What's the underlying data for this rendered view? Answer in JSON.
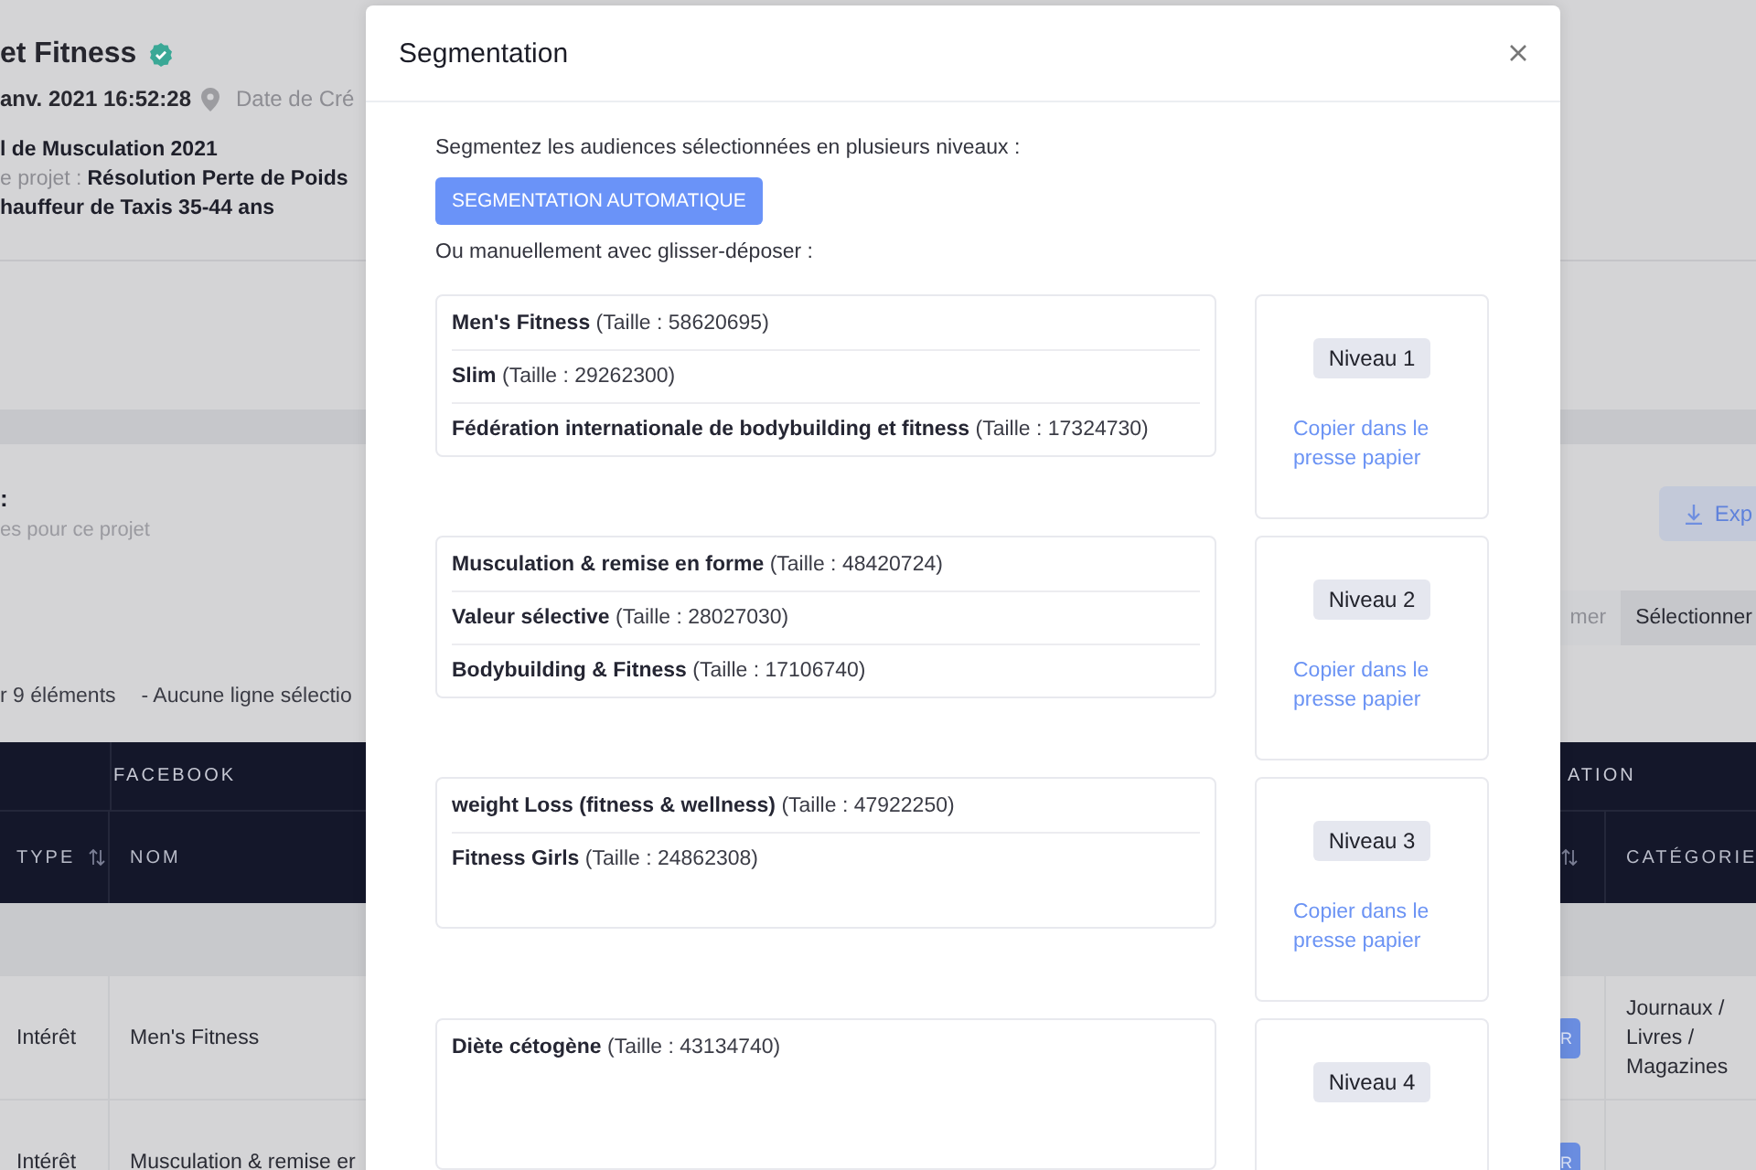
{
  "page": {
    "title": "et Fitness",
    "verified": true,
    "date": "anv. 2021 16:52:28",
    "location_label": "Date de Cré",
    "details": [
      {
        "value": "l de Musculation 2021"
      },
      {
        "label": "e projet :",
        "value": "Résolution Perte de Poids"
      },
      {
        "value": "hauffeur de Taxis 35-44 ans"
      }
    ],
    "section_title": ":",
    "section_subtitle": "es pour ce projet",
    "export_button": "Exp",
    "tabs": [
      {
        "label": "mer",
        "selected": false
      },
      {
        "label": "Sélectionner",
        "selected": true
      }
    ],
    "count": "r 9 éléments",
    "selection": "- Aucune ligne sélectio"
  },
  "table": {
    "group_headers": [
      "FACEBOOK",
      "ATION"
    ],
    "columns": [
      "TYPE",
      "NOM",
      "CATÉGORIE"
    ],
    "rows": [
      {
        "type": "Intérêt",
        "name": "Men's Fitness",
        "badge": "R",
        "category": "Journaux / Livres / Magazines"
      },
      {
        "type": "Intérêt",
        "name": "Musculation & remise er",
        "badge": "R"
      }
    ]
  },
  "modal": {
    "title": "Segmentation",
    "intro": "Segmentez les audiences sélectionnées en plusieurs niveaux :",
    "auto_button": "SEGMENTATION AUTOMATIQUE",
    "manual_text": "Ou manuellement avec glisser-déposer :",
    "levels": [
      {
        "audiences": [
          {
            "name": "Men's Fitness",
            "size": "(Taille : 58620695)"
          },
          {
            "name": "Slim",
            "size": "(Taille : 29262300)"
          },
          {
            "name": "Fédération internationale de bodybuilding et fitness",
            "size": "(Taille : 17324730)"
          }
        ],
        "label": "Niveau 1",
        "copy_link": "Copier dans le presse papier"
      },
      {
        "audiences": [
          {
            "name": "Musculation & remise en forme",
            "size": "(Taille : 48420724)"
          },
          {
            "name": "Valeur sélective",
            "size": "(Taille : 28027030)"
          },
          {
            "name": "Bodybuilding & Fitness",
            "size": "(Taille : 17106740)"
          }
        ],
        "label": "Niveau 2",
        "copy_link": "Copier dans le presse papier"
      },
      {
        "audiences": [
          {
            "name": "weight Loss (fitness & wellness)",
            "size": "(Taille : 47922250)"
          },
          {
            "name": "Fitness Girls",
            "size": "(Taille : 24862308)"
          }
        ],
        "label": "Niveau 3",
        "copy_link": "Copier dans le presse papier"
      },
      {
        "audiences": [
          {
            "name": "Diète cétogène",
            "size": "(Taille : 43134740)"
          }
        ],
        "label": "Niveau 4"
      }
    ]
  }
}
